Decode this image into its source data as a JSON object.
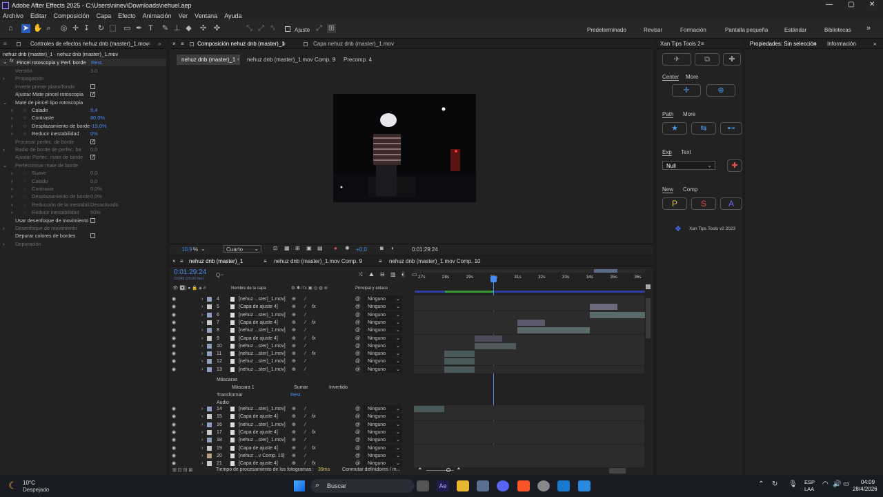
{
  "window": {
    "title": "Adobe After Effects 2025 - C:\\Users\\ninev\\Downloads\\nehuel.aep"
  },
  "menu": [
    "Archivo",
    "Editar",
    "Composición",
    "Capa",
    "Efecto",
    "Animación",
    "Ver",
    "Ventana",
    "Ayuda"
  ],
  "toolbar": {
    "snap_label": "Ajuste",
    "workspaces": [
      "Predeterminado",
      "Revisar",
      "Formación",
      "Pantalla pequeña",
      "Estándar",
      "Bibliotecas"
    ]
  },
  "effects_panel": {
    "tab": "Controles de efectos nehuz dnb (master)_1.mov",
    "subtitle": "nehuz dnb (master)_1 · nehuz dnb (master)_1.mov",
    "effect_name": "Pincel rotoscopia y Perf. borde",
    "reset": "Rest.",
    "rows": [
      {
        "label": "Versión",
        "value": "3.0",
        "dim": true,
        "indent": 1
      },
      {
        "label": "Propagación",
        "dim": true,
        "indent": 1,
        "tw": "›"
      },
      {
        "label": "Invertir primer plano/fondo",
        "dim": true,
        "indent": 1,
        "check": false
      },
      {
        "label": "Ajustar Mate pincel rotoscopia",
        "indent": 1,
        "check": true
      },
      {
        "label": "Mate de pincel tipo rotoscopia",
        "indent": 1,
        "tw": "⌄"
      },
      {
        "label": "Calado",
        "value": "9,4",
        "blue": true,
        "indent": 2,
        "tw": "›"
      },
      {
        "label": "Contraste",
        "value": "80,0%",
        "blue": true,
        "indent": 2,
        "tw": "›"
      },
      {
        "label": "Desplazamiento de borde",
        "value": "-15,0%",
        "blue": true,
        "indent": 2,
        "tw": "›"
      },
      {
        "label": "Reducir inestabilidad",
        "value": "0%",
        "blue": true,
        "indent": 2,
        "tw": "›"
      },
      {
        "label": "Procesar perfec. de borde",
        "dim": true,
        "indent": 1,
        "check": true
      },
      {
        "label": "Radio de borde de perfec. ba",
        "value": "0,0",
        "dim": true,
        "indent": 1,
        "tw": "›"
      },
      {
        "label": "Ajustar Perfec. mate de borde",
        "dim": true,
        "indent": 1,
        "check": true
      },
      {
        "label": "Perfeccionar mate de borde",
        "dim": true,
        "indent": 1,
        "tw": "⌄"
      },
      {
        "label": "Suave",
        "value": "0,0",
        "dim": true,
        "indent": 2,
        "tw": "›"
      },
      {
        "label": "Calado",
        "value": "0,0",
        "dim": true,
        "indent": 2,
        "tw": "›"
      },
      {
        "label": "Contraste",
        "value": "0,0%",
        "dim": true,
        "indent": 2,
        "tw": "›"
      },
      {
        "label": "Desplazamiento de borde",
        "value": "0,0%",
        "dim": true,
        "indent": 2,
        "tw": "›"
      },
      {
        "label": "Reducción de la inestabili",
        "value": "Desactivado",
        "dim": true,
        "indent": 2,
        "tw": "›"
      },
      {
        "label": "Reducir inestabilidad",
        "value": "50%",
        "dim": true,
        "indent": 2,
        "tw": "›"
      },
      {
        "label": "Usar desenfoque de movimiento",
        "indent": 1,
        "check": false
      },
      {
        "label": "Desenfoque de movimiento",
        "dim": true,
        "indent": 1,
        "tw": "›"
      },
      {
        "label": "Depurar colores de bordes",
        "indent": 1,
        "check": false
      },
      {
        "label": "Depuración",
        "dim": true,
        "indent": 1,
        "tw": "›"
      }
    ]
  },
  "comp_panel": {
    "tabs": [
      "Composición nehuz dnb (master)_1",
      "Capa nehuz dnb (master)_1.mov"
    ],
    "crumbs": [
      "nehuz dnb (master)_1",
      "nehuz dnb (master)_1.mov Comp. 9",
      "Precomp. 4"
    ],
    "zoom": "10,9",
    "zoom_unit": "%",
    "resolution": "Cuarto",
    "exposure": "+0,0",
    "timecode": "0:01:29:24"
  },
  "timeline": {
    "tabs": [
      "nehuz dnb (master)_1",
      "nehuz dnb (master)_1.mov Comp. 9",
      "nehuz dnb (master)_1.mov Comp. 10"
    ],
    "timecode": "0:01:29:24",
    "fps": "02249 (25,00 fps)",
    "search": "Q~",
    "col_name": "Nombre de la capa",
    "col_parent": "Principal y enlace",
    "ruler": [
      "27s",
      "28s",
      "29s",
      "30s",
      "31s",
      "32s",
      "33s",
      "34s",
      "35s",
      "36s"
    ],
    "layers": [
      {
        "n": "4",
        "name": "[nehuz ...ster)_1.mov]",
        "parent": "Ninguno",
        "color": "#8fa0b8"
      },
      {
        "n": "5",
        "name": "[Capa de ajuste 4]",
        "parent": "Ninguno",
        "color": "#c8c8c8",
        "fx": true
      },
      {
        "n": "6",
        "name": "[nehuz ...ster)_1.mov]",
        "parent": "Ninguno",
        "color": "#8fa0b8"
      },
      {
        "n": "7",
        "name": "[Capa de ajuste 4]",
        "parent": "Ninguno",
        "color": "#c8c8c8",
        "fx": true
      },
      {
        "n": "8",
        "name": "[nehuz ...ster)_1.mov]",
        "parent": "Ninguno",
        "color": "#8fa0b8"
      },
      {
        "n": "9",
        "name": "[Capa de ajuste 4]",
        "parent": "Ninguno",
        "color": "#c8c8c8",
        "fx": true
      },
      {
        "n": "10",
        "name": "[nehuz ...ster)_1.mov]",
        "parent": "Ninguno",
        "color": "#8fa0b8"
      },
      {
        "n": "11",
        "name": "[nehuz ...ster)_1.mov]",
        "parent": "Ninguno",
        "color": "#8fa0b8",
        "fx": true
      },
      {
        "n": "12",
        "name": "[nehuz ...ster)_1.mov]",
        "parent": "Ninguno",
        "color": "#8fa0b8"
      },
      {
        "n": "13",
        "name": "[nehuz ...ster)_1.mov]",
        "parent": "Ninguno",
        "color": "#8fa0b8"
      }
    ],
    "sub": {
      "masks": "Máscaras",
      "mask1": "Máscara 1",
      "mode": "Sumar",
      "inverted": "Invertido",
      "transform": "Transformar",
      "reset": "Rest.",
      "audio": "Audio"
    },
    "layers2": [
      {
        "n": "14",
        "name": "[nehuz ...ster)_1.mov]",
        "parent": "Ninguno",
        "color": "#8fa0b8"
      },
      {
        "n": "15",
        "name": "[Capa de ajuste 4]",
        "parent": "Ninguno",
        "color": "#c8c8c8",
        "fx": true
      },
      {
        "n": "16",
        "name": "[nehuz ...ster)_1.mov]",
        "parent": "Ninguno",
        "color": "#8fa0b8"
      },
      {
        "n": "17",
        "name": "[Capa de ajuste 4]",
        "parent": "Ninguno",
        "color": "#c8c8c8",
        "fx": true
      },
      {
        "n": "18",
        "name": "[nehuz ...ster)_1.mov]",
        "parent": "Ninguno",
        "color": "#8fa0b8"
      },
      {
        "n": "19",
        "name": "[Capa de ajuste 4]",
        "parent": "Ninguno",
        "color": "#c8c8c8",
        "fx": true
      },
      {
        "n": "20",
        "name": "[nehuz ...v Comp. 10]",
        "parent": "Ninguno",
        "color": "#b8a080"
      },
      {
        "n": "21",
        "name": "[Capa de ajuste 4]",
        "parent": "Ninguno",
        "color": "#c8c8c8",
        "fx": true
      }
    ],
    "status": {
      "label": "Tiempo de procesamiento de los fotogramas:",
      "value": "39ms",
      "toggle": "Conmutar definidores / m..."
    }
  },
  "xan": {
    "tab": "Xan Tips Tools 2",
    "center": "Center",
    "more": "More",
    "path": "Path",
    "more2": "More",
    "exp": "Exp",
    "text": "Text",
    "null_option": "Null",
    "new": "New",
    "comp": "Comp",
    "letters": [
      "P",
      "S",
      "A"
    ],
    "credit": "Xan Tips Tools v2 2023"
  },
  "props": {
    "tab1": "Propiedades: Sin selección",
    "tab2": "Información"
  },
  "taskbar": {
    "temp": "10°C",
    "weather": "Despejado",
    "search": "Buscar",
    "lang1": "ESP",
    "lang2": "LAA",
    "time": "04:09",
    "date": "28/4/2026"
  }
}
